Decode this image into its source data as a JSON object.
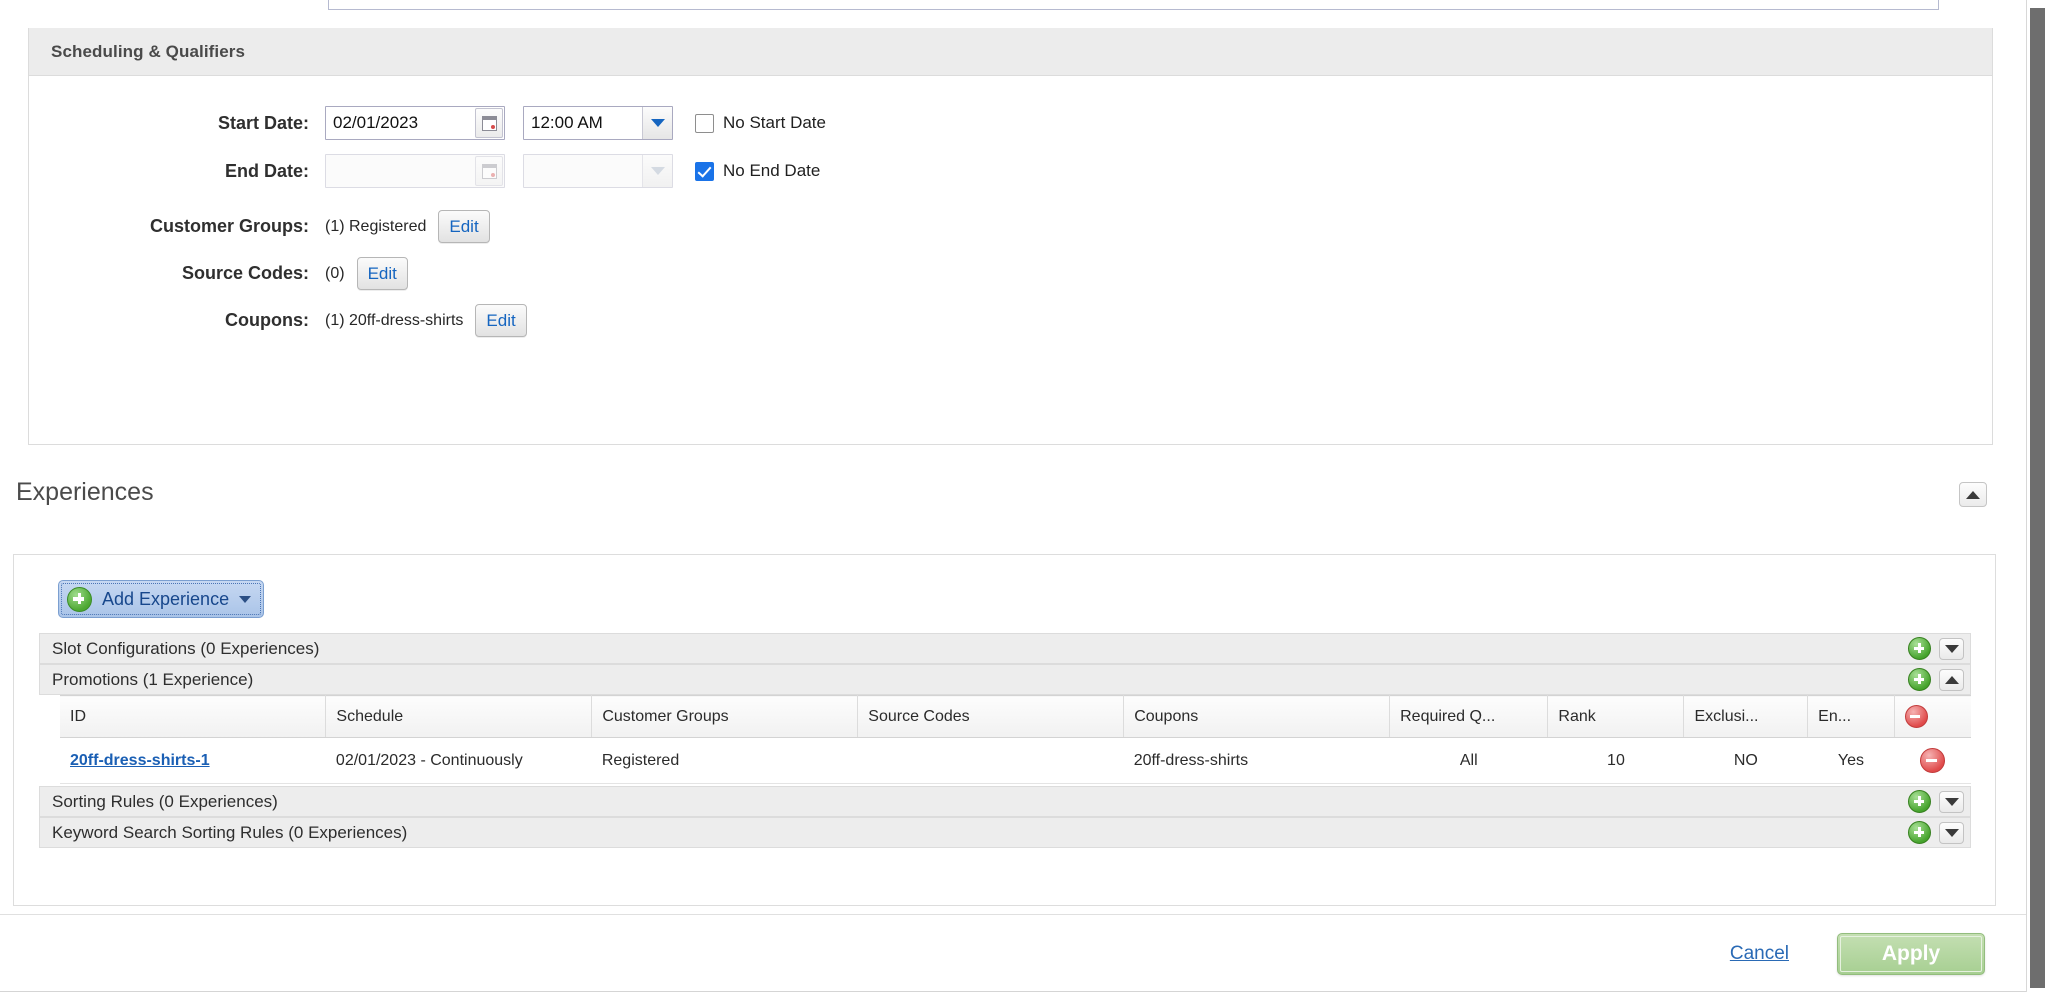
{
  "scheduling": {
    "panel_title": "Scheduling & Qualifiers",
    "start_date": {
      "label": "Start Date:",
      "value": "02/01/2023",
      "placeholder": "",
      "time_value": "12:00 AM",
      "calendar_icon": "calendar-icon",
      "dropdown_icon": "chevron-down-icon",
      "checkbox_label": "No Start Date",
      "checkbox_checked": false
    },
    "end_date": {
      "label": "End Date:",
      "value": "",
      "placeholder": "",
      "time_value": "",
      "calendar_icon": "calendar-icon",
      "dropdown_icon": "chevron-down-icon",
      "checkbox_label": "No End Date",
      "checkbox_checked": true
    },
    "customer_groups": {
      "label": "Customer Groups:",
      "value": "(1) Registered",
      "edit_label": "Edit"
    },
    "source_codes": {
      "label": "Source Codes:",
      "value": "(0)",
      "edit_label": "Edit"
    },
    "coupons": {
      "label": "Coupons:",
      "value": "(1) 20ff-dress-shirts",
      "edit_label": "Edit"
    }
  },
  "experiences": {
    "section_title": "Experiences",
    "collapse_icon": "chevron-up-icon",
    "add_button": {
      "label": "Add Experience",
      "plus_icon": "plus-circle-icon",
      "caret_icon": "chevron-down-icon"
    },
    "groups": [
      {
        "label": "Slot Configurations (0 Experiences)",
        "add_icon": "plus-circle-icon",
        "toggle_icon": "chevron-down-icon",
        "expanded": false
      },
      {
        "label": "Promotions (1 Experience)",
        "add_icon": "plus-circle-icon",
        "toggle_icon": "chevron-up-icon",
        "expanded": true
      },
      {
        "label": "Sorting Rules (0 Experiences)",
        "add_icon": "plus-circle-icon",
        "toggle_icon": "chevron-down-icon",
        "expanded": false
      },
      {
        "label": "Keyword Search Sorting Rules (0 Experiences)",
        "add_icon": "plus-circle-icon",
        "toggle_icon": "chevron-down-icon",
        "expanded": false
      }
    ],
    "table": {
      "columns": [
        "ID",
        "Schedule",
        "Customer Groups",
        "Source Codes",
        "Coupons",
        "Required Q...",
        "Rank",
        "Exclusi...",
        "En...",
        ""
      ],
      "header_remove_icon": "remove-circle-icon",
      "rows": [
        {
          "id": "20ff-dress-shirts-1",
          "schedule": "02/01/2023 - Continuously",
          "customer_groups": "Registered",
          "source_codes": "",
          "coupons": "20ff-dress-shirts",
          "required_qualifiers": "All",
          "rank": "10",
          "exclusive": "NO",
          "enabled": "Yes",
          "remove_icon": "remove-circle-icon"
        }
      ]
    }
  },
  "footer": {
    "cancel_label": "Cancel",
    "apply_label": "Apply"
  },
  "colors": {
    "link": "#1a5fb4",
    "accent_green": "#17b217",
    "apply_green": "#a7cf92",
    "checkbox_blue": "#1a73e8",
    "remove_red": "#e04a4a",
    "panel_header_bg": "#ececec"
  }
}
